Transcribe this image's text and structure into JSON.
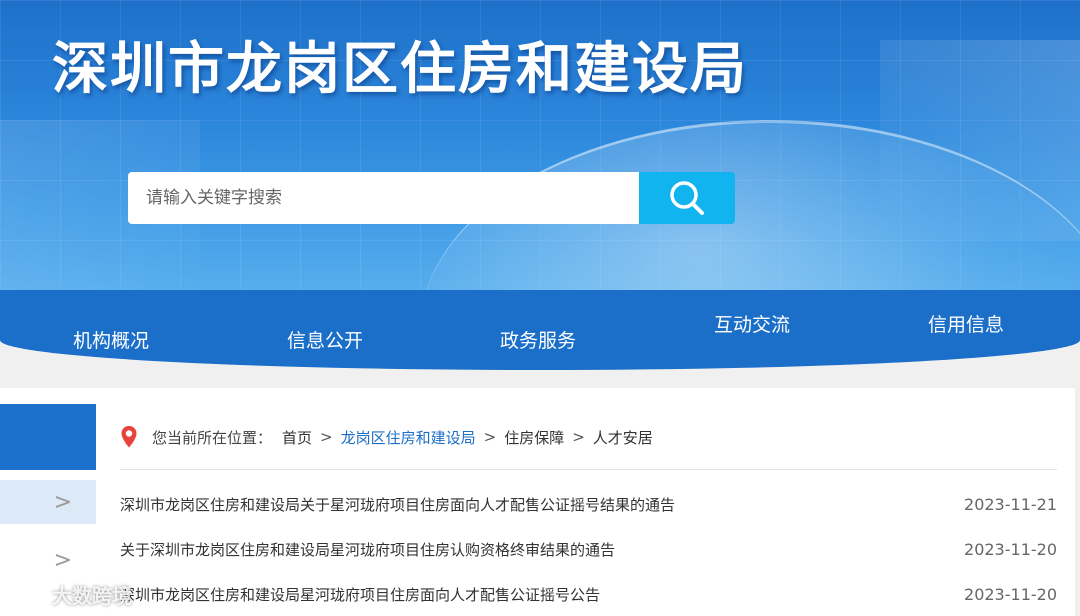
{
  "header": {
    "site_title": "深圳市龙岗区住房和建设局"
  },
  "search": {
    "placeholder": "请输入关键字搜索",
    "button_icon": "search-icon"
  },
  "nav": {
    "items": [
      {
        "label": "机构概况"
      },
      {
        "label": "信息公开"
      },
      {
        "label": "政务服务"
      },
      {
        "label": "互动交流"
      },
      {
        "label": "信用信息"
      }
    ]
  },
  "breadcrumb": {
    "icon": "location-pin-icon",
    "prefix": "您当前所在位置：",
    "items": [
      {
        "label": "首页"
      },
      {
        "label": "龙岗区住房和建设局"
      },
      {
        "label": "住房保障"
      },
      {
        "label": "人才安居"
      }
    ],
    "separator": ">"
  },
  "news": [
    {
      "title": "深圳市龙岗区住房和建设局关于星河珑府项目住房面向人才配售公证摇号结果的通告",
      "date": "2023-11-21"
    },
    {
      "title": "关于深圳市龙岗区住房和建设局星河珑府项目住房认购资格终审结果的通告",
      "date": "2023-11-20"
    },
    {
      "title": "深圳市龙岗区住房和建设局星河珑府项目住房面向人才配售公证摇号公告",
      "date": "2023-11-20"
    }
  ],
  "sidebar": {
    "chevron": ">"
  },
  "watermark": {
    "text": "大数跨境"
  },
  "colors": {
    "primary_blue": "#1c71cc",
    "search_button": "#12b4ef",
    "link_blue": "#1c6fc6",
    "pin_red": "#e8423c"
  }
}
